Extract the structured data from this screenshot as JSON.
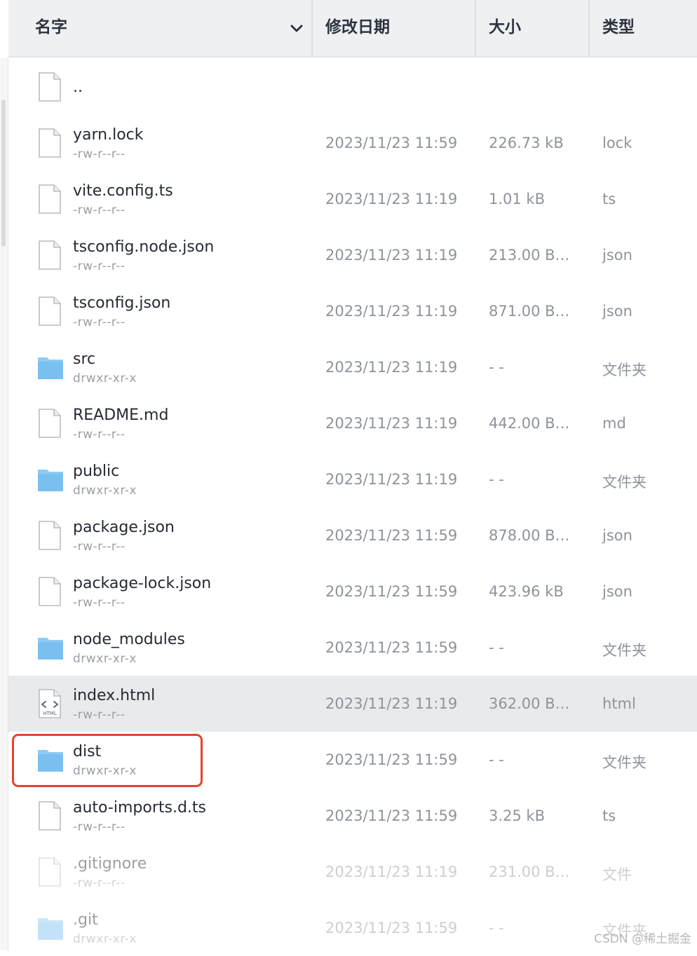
{
  "header": {
    "name": "名字",
    "date": "修改日期",
    "size": "大小",
    "type": "类型"
  },
  "rows": [
    {
      "name": "..",
      "perm": "",
      "date": "",
      "size": "",
      "type": "",
      "icon": "file-icon"
    },
    {
      "name": "yarn.lock",
      "perm": "-rw-r--r--",
      "date": "2023/11/23 11:59",
      "size": "226.73 kB",
      "type": "lock",
      "icon": "file-icon"
    },
    {
      "name": "vite.config.ts",
      "perm": "-rw-r--r--",
      "date": "2023/11/23 11:19",
      "size": "1.01 kB",
      "type": "ts",
      "icon": "file-icon"
    },
    {
      "name": "tsconfig.node.json",
      "perm": "-rw-r--r--",
      "date": "2023/11/23 11:19",
      "size": "213.00 B…",
      "type": "json",
      "icon": "file-icon"
    },
    {
      "name": "tsconfig.json",
      "perm": "-rw-r--r--",
      "date": "2023/11/23 11:19",
      "size": "871.00 B…",
      "type": "json",
      "icon": "file-icon"
    },
    {
      "name": "src",
      "perm": "drwxr-xr-x",
      "date": "2023/11/23 11:19",
      "size": "- -",
      "type": "文件夹",
      "icon": "folder-icon"
    },
    {
      "name": "README.md",
      "perm": "-rw-r--r--",
      "date": "2023/11/23 11:19",
      "size": "442.00 B…",
      "type": "md",
      "icon": "file-icon"
    },
    {
      "name": "public",
      "perm": "drwxr-xr-x",
      "date": "2023/11/23 11:19",
      "size": "- -",
      "type": "文件夹",
      "icon": "folder-icon"
    },
    {
      "name": "package.json",
      "perm": "-rw-r--r--",
      "date": "2023/11/23 11:59",
      "size": "878.00 B…",
      "type": "json",
      "icon": "file-icon"
    },
    {
      "name": "package-lock.json",
      "perm": "-rw-r--r--",
      "date": "2023/11/23 11:59",
      "size": "423.96 kB",
      "type": "json",
      "icon": "file-icon"
    },
    {
      "name": "node_modules",
      "perm": "drwxr-xr-x",
      "date": "2023/11/23 11:59",
      "size": "- -",
      "type": "文件夹",
      "icon": "folder-icon"
    },
    {
      "name": "index.html",
      "perm": "-rw-r--r--",
      "date": "2023/11/23 11:19",
      "size": "362.00 B…",
      "type": "html",
      "icon": "html-file-icon"
    },
    {
      "name": "dist",
      "perm": "drwxr-xr-x",
      "date": "2023/11/23 11:59",
      "size": "- -",
      "type": "文件夹",
      "icon": "folder-icon"
    },
    {
      "name": "auto-imports.d.ts",
      "perm": "-rw-r--r--",
      "date": "2023/11/23 11:59",
      "size": "3.25 kB",
      "type": "ts",
      "icon": "file-icon"
    },
    {
      "name": ".gitignore",
      "perm": "-rw-r--r--",
      "date": "2023/11/23 11:19",
      "size": "231.00 B…",
      "type": "文件",
      "icon": "file-icon"
    },
    {
      "name": ".git",
      "perm": "drwxr-xr-x",
      "date": "2023/11/23 11:59",
      "size": "- -",
      "type": "文件夹",
      "icon": "folder-icon"
    }
  ],
  "html_icon_text": "HTML",
  "watermark": "CSDN @稀土掘金"
}
